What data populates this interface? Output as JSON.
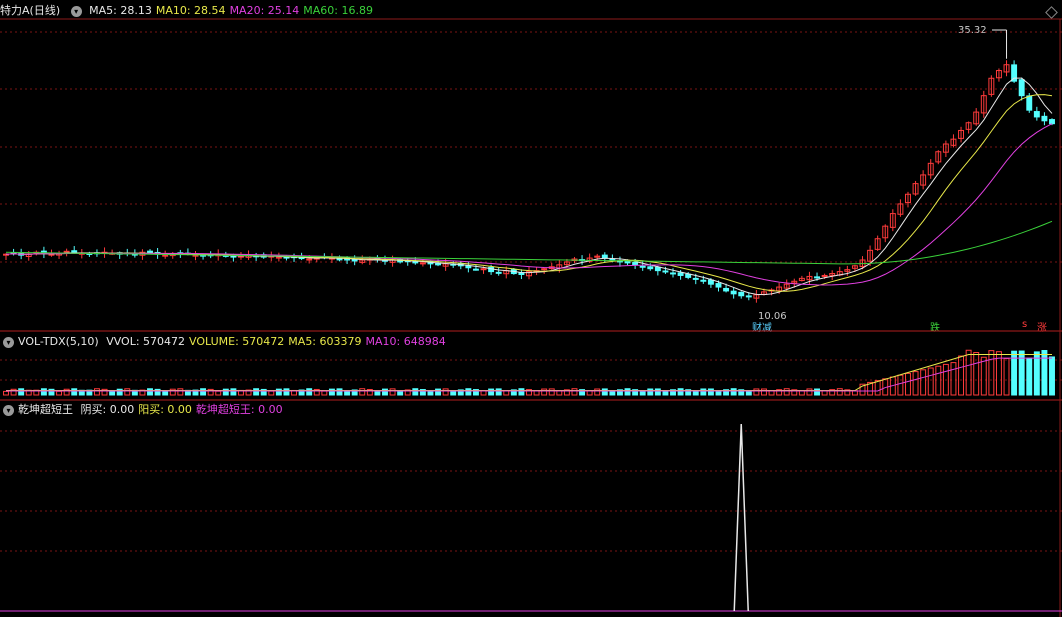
{
  "main_panel": {
    "stock_name": "特力A",
    "period": "(日线)",
    "indicators": [
      {
        "label": "MA5: 28.13",
        "color": "#e8e8e8"
      },
      {
        "label": "MA10: 28.54",
        "color": "#e8e84a"
      },
      {
        "label": "MA20: 25.14",
        "color": "#e040e0"
      },
      {
        "label": "MA60: 16.89",
        "color": "#3ad13a"
      }
    ],
    "high_label": "35.32",
    "low_label": "10.06",
    "signal_left": "财减",
    "signal_mid": "跌",
    "signal_right_1": "s",
    "signal_right_2": "涨"
  },
  "vol_panel": {
    "name": "VOL-TDX(5,10)",
    "items": [
      {
        "label": "VVOL: 570472",
        "color": "#e8e8e8"
      },
      {
        "label": "VOLUME: 570472",
        "color": "#e8e84a"
      },
      {
        "label": "MA5: 603379",
        "color": "#e8e84a"
      },
      {
        "label": "MA10: 648984",
        "color": "#e040e0"
      }
    ]
  },
  "sig_panel": {
    "name": "乾坤超短王",
    "items": [
      {
        "label": "阴买: 0.00",
        "color": "#e8e8e8"
      },
      {
        "label": "阳买: 0.00",
        "color": "#e8e84a"
      },
      {
        "label": "乾坤超短王: 0.00",
        "color": "#e040e0"
      }
    ]
  },
  "chart_data": {
    "type": "candlestick",
    "y_range": [
      8,
      38
    ],
    "up_color": "#ff3b3b",
    "down_color": "#54ffff",
    "ma_colors": [
      "#e8e8e8",
      "#e8e84a",
      "#e040e0",
      "#3ad13a"
    ],
    "closes": [
      14.6,
      14.7,
      14.5,
      14.6,
      14.8,
      14.7,
      14.6,
      14.7,
      14.9,
      14.8,
      14.7,
      14.6,
      14.7,
      14.8,
      14.7,
      14.6,
      14.7,
      14.6,
      14.8,
      14.7,
      14.6,
      14.5,
      14.6,
      14.7,
      14.6,
      14.5,
      14.4,
      14.5,
      14.6,
      14.4,
      14.3,
      14.4,
      14.5,
      14.4,
      14.3,
      14.4,
      14.3,
      14.2,
      14.3,
      14.2,
      14.1,
      14.2,
      14.3,
      14.2,
      14.1,
      14.0,
      13.9,
      14.0,
      14.1,
      14.0,
      13.9,
      14.0,
      13.8,
      13.9,
      13.8,
      13.7,
      13.6,
      13.5,
      13.6,
      13.5,
      13.4,
      13.2,
      13.0,
      13.1,
      12.8,
      12.7,
      12.9,
      12.6,
      12.5,
      12.8,
      12.9,
      13.1,
      13.3,
      13.5,
      13.8,
      14.1,
      14.0,
      14.2,
      14.4,
      14.2,
      14.0,
      13.8,
      13.7,
      13.5,
      13.3,
      13.1,
      12.9,
      12.8,
      12.6,
      12.4,
      12.2,
      12.0,
      11.8,
      11.5,
      11.2,
      10.8,
      10.5,
      10.3,
      10.2,
      10.4,
      10.7,
      10.9,
      11.2,
      11.5,
      11.8,
      12.1,
      12.3,
      12.2,
      12.4,
      12.6,
      12.8,
      13.0,
      13.4,
      14.0,
      15.0,
      16.2,
      17.5,
      18.8,
      19.8,
      20.8,
      21.9,
      22.8,
      24.0,
      25.2,
      26.0,
      26.5,
      27.4,
      28.2,
      29.3,
      31.0,
      32.8,
      33.6,
      34.2,
      32.5,
      31.0,
      29.5,
      28.8,
      28.4,
      28.1
    ],
    "ma60_start": [
      14.8,
      13.3
    ],
    "volume_values_note": "relative",
    "signal_spike_index": 97
  }
}
